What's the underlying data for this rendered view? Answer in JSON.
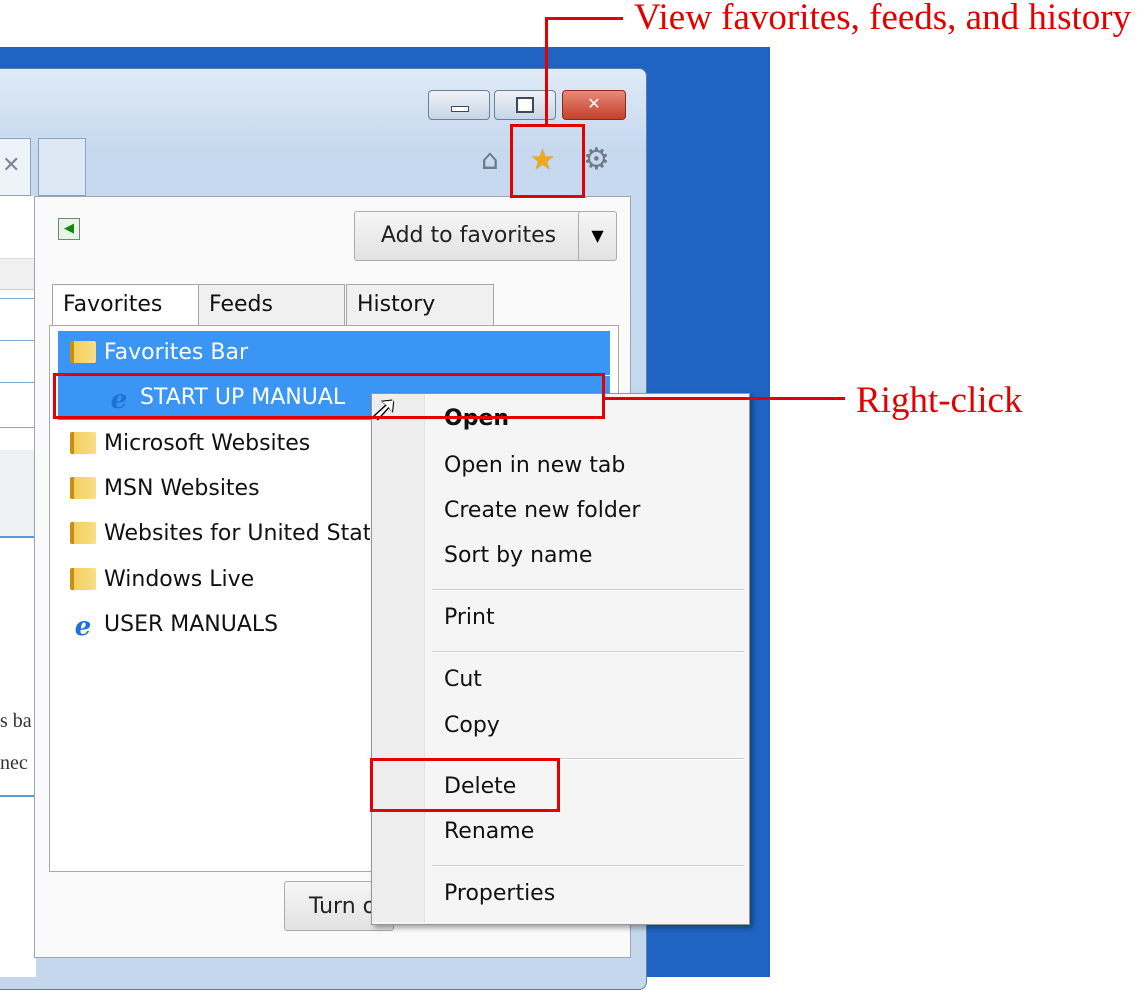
{
  "window": {
    "buttons": {
      "minimize_icon": "minimize-icon",
      "maximize_icon": "maximize-icon",
      "close_icon": "close-icon",
      "close_glyph": "✕"
    },
    "toolbar_icons": {
      "home": "home-icon",
      "favorites": "favorites-star-icon",
      "tools": "gear-icon"
    }
  },
  "background_text": {
    "line1": "s ba",
    "line2": "nec"
  },
  "favorites_center": {
    "pin_icon": "pin-arrow-icon",
    "add_button": "Add to favorites",
    "add_dropdown_icon": "dropdown-arrow-icon",
    "tabs": [
      {
        "label": "Favorites"
      },
      {
        "label": "Feeds"
      },
      {
        "label": "History"
      }
    ],
    "items": [
      {
        "label": "Favorites Bar",
        "icon": "folder-icon"
      },
      {
        "label": "START UP MANUAL",
        "icon": "ie-icon"
      },
      {
        "label": "Microsoft Websites",
        "icon": "folder-icon"
      },
      {
        "label": "MSN Websites",
        "icon": "folder-icon"
      },
      {
        "label": "Websites for United State",
        "icon": "folder-icon"
      },
      {
        "label": "Windows Live",
        "icon": "folder-icon"
      },
      {
        "label": "USER MANUALS",
        "icon": "ie-icon"
      }
    ],
    "turn_button": "Turn o"
  },
  "context_menu": {
    "items": [
      {
        "label": "Open"
      },
      {
        "label": "Open in new tab"
      },
      {
        "label": "Create new folder"
      },
      {
        "label": "Sort by name"
      },
      {
        "label": "Print"
      },
      {
        "label": "Cut"
      },
      {
        "label": "Copy"
      },
      {
        "label": "Delete"
      },
      {
        "label": "Rename"
      },
      {
        "label": "Properties"
      }
    ]
  },
  "annotations": {
    "favorites_callout": "View favorites, feeds, and history",
    "rightclick_callout": "Right-click",
    "color": "#e20000"
  }
}
